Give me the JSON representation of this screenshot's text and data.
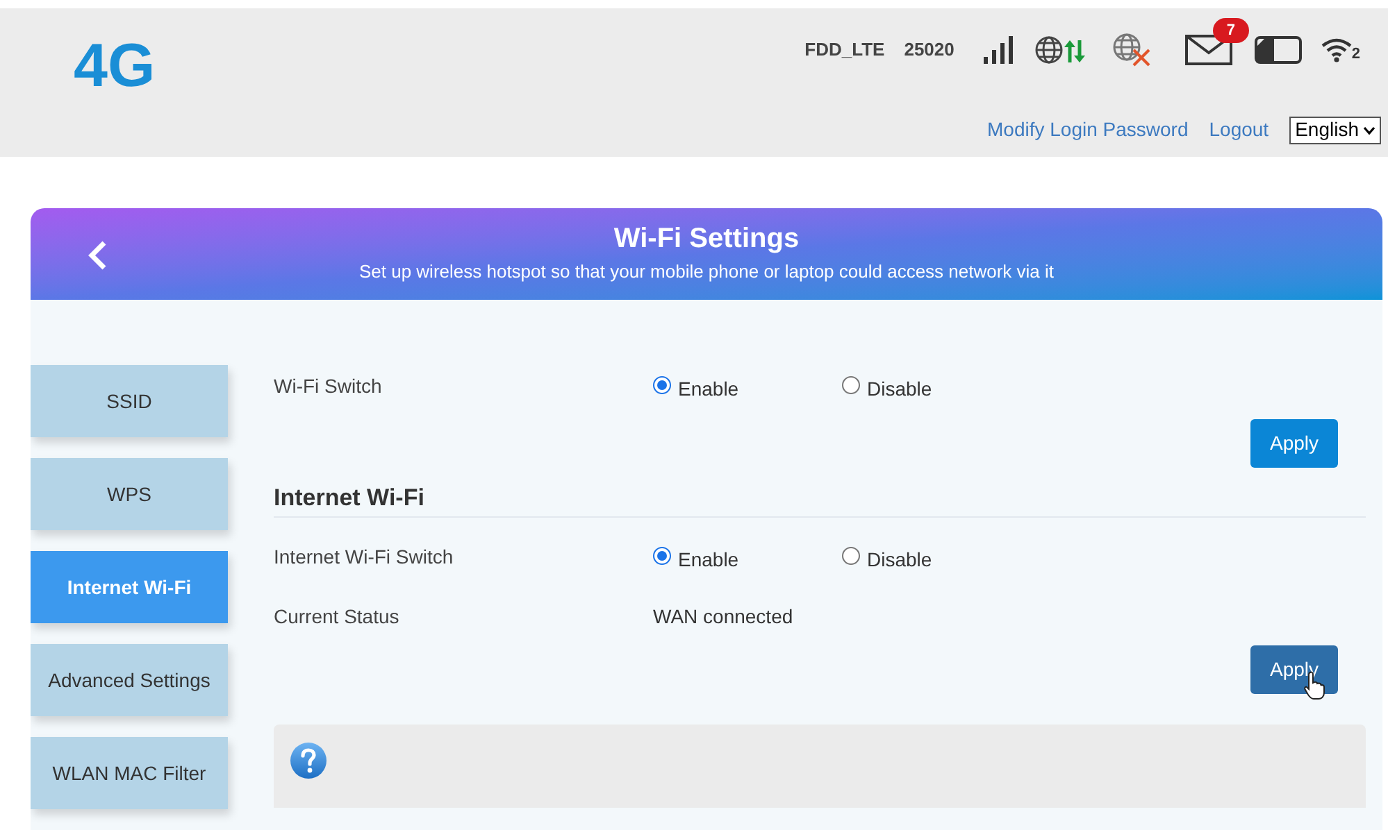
{
  "header": {
    "logo": "4G",
    "network_type": "FDD_LTE",
    "operator": "25020",
    "unread_messages": "7",
    "wifi_clients": "2",
    "links": [
      "Modify Login Password",
      "Logout"
    ],
    "language": "English"
  },
  "banner": {
    "title": "Wi-Fi Settings",
    "subtitle": "Set up wireless hotspot so that your mobile phone or laptop could access network via it"
  },
  "sidebar": [
    {
      "label": "SSID",
      "selected": false
    },
    {
      "label": "WPS",
      "selected": false
    },
    {
      "label": "Internet Wi-Fi",
      "selected": true
    },
    {
      "label": "Advanced Settings",
      "selected": false
    },
    {
      "label": "WLAN MAC Filter",
      "selected": false
    }
  ],
  "sections": [
    {
      "rows": [
        {
          "kind": "radio",
          "label": "Wi-Fi Switch",
          "options": [
            {
              "label": "Enable",
              "selected": true
            },
            {
              "label": "Disable",
              "selected": false
            }
          ]
        }
      ],
      "apply": {
        "label": "Apply",
        "hovered": false
      }
    },
    {
      "title": "Internet Wi-Fi",
      "rows": [
        {
          "kind": "radio",
          "label": "Internet Wi-Fi Switch",
          "options": [
            {
              "label": "Enable",
              "selected": true
            },
            {
              "label": "Disable",
              "selected": false
            }
          ]
        },
        {
          "kind": "text",
          "label": "Current Status",
          "value": "WAN connected"
        }
      ],
      "apply": {
        "label": "Apply",
        "hovered": true
      }
    }
  ]
}
